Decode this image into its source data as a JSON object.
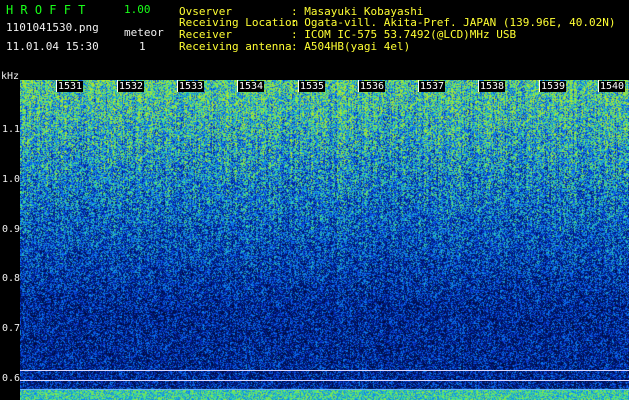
{
  "header": {
    "app_title": "HROFFT",
    "version": "1.00",
    "filename": "1101041530.png",
    "meteor_label": "meteor",
    "datetime": "11.01.04 15:30",
    "meteor_count": "1"
  },
  "info": [
    {
      "key": "Ovserver",
      "value": ": Masayuki Kobayashi"
    },
    {
      "key": "Receiving Location",
      "value": ": Ogata-vill. Akita-Pref. JAPAN (139.96E, 40.02N)"
    },
    {
      "key": "Receiver",
      "value": ": ICOM IC-575 53.7492(@LCD)MHz USB"
    },
    {
      "key": "Receiving antenna",
      "value": ": A504HB(yagi 4el)"
    }
  ],
  "axis": {
    "y_unit": "kHz",
    "y_ticks": [
      "1.1",
      "1.0",
      "0.9",
      "0.8",
      "0.7",
      "0.6"
    ],
    "x_ticks": [
      "1531",
      "1532",
      "1533",
      "1534",
      "1535",
      "1536",
      "1537",
      "1538",
      "1539",
      "1540"
    ]
  },
  "colors": {
    "label_green": "#19ff19",
    "label_yellow": "#ffff33",
    "spectrum_deep": "#0a1a7a",
    "spectrum_mid": "#2a5aff",
    "spectrum_high": "#33e0d0",
    "spectrum_peak": "#b0ff40"
  }
}
